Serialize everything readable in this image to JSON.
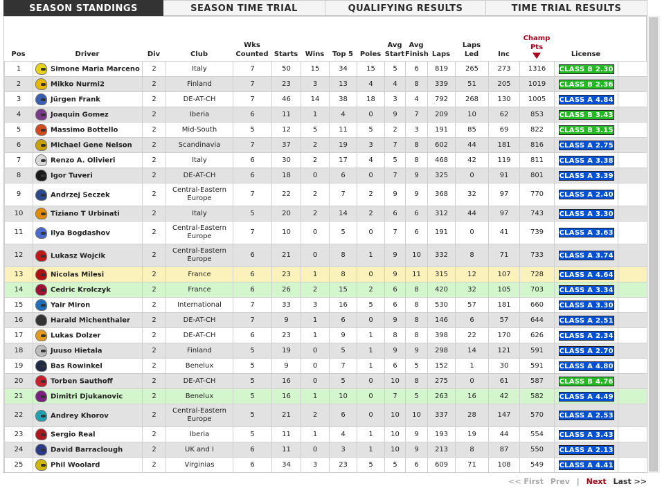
{
  "tabs": [
    {
      "label": "SEASON STANDINGS",
      "active": true
    },
    {
      "label": "SEASON TIME TRIAL",
      "active": false
    },
    {
      "label": "QUALIFYING RESULTS",
      "active": false
    },
    {
      "label": "TIME TRIAL RESULTS",
      "active": false
    }
  ],
  "columns": {
    "pos": "Pos",
    "driver": "Driver",
    "div": "Div",
    "club": "Club",
    "wks_line1": "Wks",
    "wks_line2": "Counted",
    "starts": "Starts",
    "wins": "Wins",
    "top5": "Top 5",
    "poles": "Poles",
    "avg_start_line1": "Avg",
    "avg_start_line2": "Start",
    "avg_finish_line1": "Avg",
    "avg_finish_line2": "Finish",
    "laps": "Laps",
    "laps_led_line1": "Laps",
    "laps_led_line2": "Led",
    "inc": "Inc",
    "champ_line1": "Champ",
    "champ_line2": "Pts",
    "license": "License"
  },
  "sort_icon": "sort-down-arrow-icon",
  "colors": {
    "accent": "#b0001b",
    "license_a": "#0050d8",
    "license_b": "#22bb22",
    "highlight_yellow": "#fbf1bb",
    "highlight_green": "#d4f6cc"
  },
  "rows": [
    {
      "pos": "1",
      "driver": "Simone Maria Marceno",
      "div": "2",
      "club": "Italy",
      "wks": "7",
      "starts": "50",
      "wins": "15",
      "top5": "34",
      "poles": "15",
      "avg_start": "5",
      "avg_finish": "6",
      "laps": "819",
      "laps_led": "265",
      "inc": "273",
      "pts": "1316",
      "license": "CLASS B 2.30",
      "license_class": "b",
      "helmet": "#e8d21a",
      "tall": false,
      "highlight": ""
    },
    {
      "pos": "2",
      "driver": "Mikko Nurmi2",
      "div": "2",
      "club": "Finland",
      "wks": "7",
      "starts": "23",
      "wins": "3",
      "top5": "13",
      "poles": "4",
      "avg_start": "4",
      "avg_finish": "8",
      "laps": "339",
      "laps_led": "51",
      "inc": "205",
      "pts": "1019",
      "license": "CLASS B 2.36",
      "license_class": "b",
      "helmet": "#e6b800",
      "tall": false,
      "highlight": ""
    },
    {
      "pos": "3",
      "driver": "Jürgen Frank",
      "div": "2",
      "club": "DE-AT-CH",
      "wks": "7",
      "starts": "46",
      "wins": "14",
      "top5": "38",
      "poles": "18",
      "avg_start": "3",
      "avg_finish": "4",
      "laps": "792",
      "laps_led": "268",
      "inc": "130",
      "pts": "1005",
      "license": "CLASS A 4.84",
      "license_class": "a",
      "helmet": "#3a5fb0",
      "tall": false,
      "highlight": ""
    },
    {
      "pos": "4",
      "driver": "Joaquin Gomez",
      "div": "2",
      "club": "Iberia",
      "wks": "6",
      "starts": "11",
      "wins": "1",
      "top5": "4",
      "poles": "0",
      "avg_start": "9",
      "avg_finish": "7",
      "laps": "209",
      "laps_led": "10",
      "inc": "62",
      "pts": "853",
      "license": "CLASS B 3.43",
      "license_class": "b",
      "helmet": "#7a3a8a",
      "tall": false,
      "highlight": ""
    },
    {
      "pos": "5",
      "driver": "Massimo Bottello",
      "div": "2",
      "club": "Mid-South",
      "wks": "5",
      "starts": "12",
      "wins": "5",
      "top5": "11",
      "poles": "5",
      "avg_start": "2",
      "avg_finish": "3",
      "laps": "191",
      "laps_led": "85",
      "inc": "69",
      "pts": "822",
      "license": "CLASS B 3.15",
      "license_class": "b",
      "helmet": "#d04a1c",
      "tall": false,
      "highlight": ""
    },
    {
      "pos": "6",
      "driver": "Michael Gene Nelson",
      "div": "2",
      "club": "Scandinavia",
      "wks": "7",
      "starts": "37",
      "wins": "2",
      "top5": "19",
      "poles": "3",
      "avg_start": "7",
      "avg_finish": "8",
      "laps": "602",
      "laps_led": "44",
      "inc": "181",
      "pts": "816",
      "license": "CLASS A 2.75",
      "license_class": "a",
      "helmet": "#c8a000",
      "tall": false,
      "highlight": ""
    },
    {
      "pos": "7",
      "driver": "Renzo A. Olivieri",
      "div": "2",
      "club": "Italy",
      "wks": "6",
      "starts": "30",
      "wins": "2",
      "top5": "17",
      "poles": "4",
      "avg_start": "5",
      "avg_finish": "8",
      "laps": "468",
      "laps_led": "42",
      "inc": "119",
      "pts": "811",
      "license": "CLASS A 3.38",
      "license_class": "a",
      "helmet": "#d8d8d8",
      "tall": false,
      "highlight": ""
    },
    {
      "pos": "8",
      "driver": "Igor Tuveri",
      "div": "2",
      "club": "DE-AT-CH",
      "wks": "6",
      "starts": "18",
      "wins": "0",
      "top5": "6",
      "poles": "0",
      "avg_start": "7",
      "avg_finish": "9",
      "laps": "325",
      "laps_led": "0",
      "inc": "91",
      "pts": "801",
      "license": "CLASS A 3.39",
      "license_class": "a",
      "helmet": "#1a1a1a",
      "tall": false,
      "highlight": ""
    },
    {
      "pos": "9",
      "driver": "Andrzej Seczek",
      "div": "2",
      "club": "Central-Eastern Europe",
      "wks": "7",
      "starts": "22",
      "wins": "2",
      "top5": "7",
      "poles": "2",
      "avg_start": "9",
      "avg_finish": "9",
      "laps": "368",
      "laps_led": "32",
      "inc": "97",
      "pts": "770",
      "license": "CLASS A 2.40",
      "license_class": "a",
      "helmet": "#2d4a8c",
      "tall": true,
      "highlight": ""
    },
    {
      "pos": "10",
      "driver": "Tiziano T Urbinati",
      "div": "2",
      "club": "Italy",
      "wks": "5",
      "starts": "20",
      "wins": "2",
      "top5": "14",
      "poles": "2",
      "avg_start": "6",
      "avg_finish": "6",
      "laps": "312",
      "laps_led": "44",
      "inc": "97",
      "pts": "743",
      "license": "CLASS A 3.30",
      "license_class": "a",
      "helmet": "#e28a00",
      "tall": false,
      "highlight": ""
    },
    {
      "pos": "11",
      "driver": "Ilya Bogdashov",
      "div": "2",
      "club": "Central-Eastern Europe",
      "wks": "7",
      "starts": "10",
      "wins": "0",
      "top5": "5",
      "poles": "0",
      "avg_start": "7",
      "avg_finish": "6",
      "laps": "191",
      "laps_led": "0",
      "inc": "41",
      "pts": "739",
      "license": "CLASS A 3.63",
      "license_class": "a",
      "helmet": "#4a6ad0",
      "tall": true,
      "highlight": ""
    },
    {
      "pos": "12",
      "driver": "Lukasz Wojcik",
      "div": "2",
      "club": "Central-Eastern Europe",
      "wks": "6",
      "starts": "21",
      "wins": "0",
      "top5": "8",
      "poles": "1",
      "avg_start": "9",
      "avg_finish": "10",
      "laps": "332",
      "laps_led": "8",
      "inc": "71",
      "pts": "733",
      "license": "CLASS A 3.74",
      "license_class": "a",
      "helmet": "#c01818",
      "tall": true,
      "highlight": ""
    },
    {
      "pos": "13",
      "driver": "Nicolas Milesi",
      "div": "2",
      "club": "France",
      "wks": "6",
      "starts": "23",
      "wins": "1",
      "top5": "8",
      "poles": "0",
      "avg_start": "9",
      "avg_finish": "11",
      "laps": "315",
      "laps_led": "12",
      "inc": "107",
      "pts": "728",
      "license": "CLASS A 4.64",
      "license_class": "a",
      "helmet": "#b01010",
      "tall": false,
      "highlight": "yellow"
    },
    {
      "pos": "14",
      "driver": "Cedric Krolczyk",
      "div": "2",
      "club": "France",
      "wks": "6",
      "starts": "26",
      "wins": "2",
      "top5": "15",
      "poles": "2",
      "avg_start": "6",
      "avg_finish": "8",
      "laps": "420",
      "laps_led": "32",
      "inc": "105",
      "pts": "703",
      "license": "CLASS A 3.34",
      "license_class": "a",
      "helmet": "#a01030",
      "tall": false,
      "highlight": "green"
    },
    {
      "pos": "15",
      "driver": "Yair Miron",
      "div": "2",
      "club": "International",
      "wks": "7",
      "starts": "33",
      "wins": "3",
      "top5": "16",
      "poles": "5",
      "avg_start": "6",
      "avg_finish": "8",
      "laps": "530",
      "laps_led": "57",
      "inc": "181",
      "pts": "660",
      "license": "CLASS A 3.30",
      "license_class": "a",
      "helmet": "#1f6fb8",
      "tall": false,
      "highlight": ""
    },
    {
      "pos": "16",
      "driver": "Harald Michenthaler",
      "div": "2",
      "club": "DE-AT-CH",
      "wks": "7",
      "starts": "9",
      "wins": "1",
      "top5": "6",
      "poles": "0",
      "avg_start": "9",
      "avg_finish": "8",
      "laps": "146",
      "laps_led": "6",
      "inc": "57",
      "pts": "644",
      "license": "CLASS A 2.51",
      "license_class": "a",
      "helmet": "#333333",
      "tall": false,
      "highlight": ""
    },
    {
      "pos": "17",
      "driver": "Lukas Dolzer",
      "div": "2",
      "club": "DE-AT-CH",
      "wks": "6",
      "starts": "23",
      "wins": "1",
      "top5": "9",
      "poles": "1",
      "avg_start": "8",
      "avg_finish": "8",
      "laps": "398",
      "laps_led": "22",
      "inc": "170",
      "pts": "626",
      "license": "CLASS A 2.34",
      "license_class": "a",
      "helmet": "#e29a20",
      "tall": false,
      "highlight": ""
    },
    {
      "pos": "18",
      "driver": "Juuso Hietala",
      "div": "2",
      "club": "Finland",
      "wks": "5",
      "starts": "19",
      "wins": "0",
      "top5": "5",
      "poles": "1",
      "avg_start": "9",
      "avg_finish": "9",
      "laps": "298",
      "laps_led": "14",
      "inc": "121",
      "pts": "591",
      "license": "CLASS A 2.70",
      "license_class": "a",
      "helmet": "#bcbcbc",
      "tall": false,
      "highlight": ""
    },
    {
      "pos": "19",
      "driver": "Bas Rowinkel",
      "div": "2",
      "club": "Benelux",
      "wks": "5",
      "starts": "9",
      "wins": "0",
      "top5": "7",
      "poles": "1",
      "avg_start": "6",
      "avg_finish": "5",
      "laps": "152",
      "laps_led": "1",
      "inc": "30",
      "pts": "591",
      "license": "CLASS A 4.80",
      "license_class": "a",
      "helmet": "#202a44",
      "tall": false,
      "highlight": ""
    },
    {
      "pos": "20",
      "driver": "Torben Sauthoff",
      "div": "2",
      "club": "DE-AT-CH",
      "wks": "5",
      "starts": "16",
      "wins": "0",
      "top5": "5",
      "poles": "0",
      "avg_start": "10",
      "avg_finish": "8",
      "laps": "275",
      "laps_led": "0",
      "inc": "61",
      "pts": "587",
      "license": "CLASS B 4.76",
      "license_class": "b",
      "helmet": "#c8202a",
      "tall": false,
      "highlight": ""
    },
    {
      "pos": "21",
      "driver": "Dimitri Djukanovic",
      "div": "2",
      "club": "Benelux",
      "wks": "5",
      "starts": "16",
      "wins": "1",
      "top5": "10",
      "poles": "0",
      "avg_start": "7",
      "avg_finish": "5",
      "laps": "263",
      "laps_led": "16",
      "inc": "42",
      "pts": "582",
      "license": "CLASS A 4.49",
      "license_class": "a",
      "helmet": "#7a2080",
      "tall": false,
      "highlight": "green"
    },
    {
      "pos": "22",
      "driver": "Andrey Khorov",
      "div": "2",
      "club": "Central-Eastern Europe",
      "wks": "5",
      "starts": "21",
      "wins": "2",
      "top5": "6",
      "poles": "0",
      "avg_start": "10",
      "avg_finish": "10",
      "laps": "337",
      "laps_led": "28",
      "inc": "147",
      "pts": "570",
      "license": "CLASS A 2.53",
      "license_class": "a",
      "helmet": "#20a0b0",
      "tall": true,
      "highlight": ""
    },
    {
      "pos": "23",
      "driver": "Sergio Real",
      "div": "2",
      "club": "Iberia",
      "wks": "5",
      "starts": "11",
      "wins": "1",
      "top5": "4",
      "poles": "1",
      "avg_start": "10",
      "avg_finish": "9",
      "laps": "193",
      "laps_led": "19",
      "inc": "44",
      "pts": "554",
      "license": "CLASS A 3.43",
      "license_class": "a",
      "helmet": "#b01820",
      "tall": false,
      "highlight": ""
    },
    {
      "pos": "24",
      "driver": "David Barraclough",
      "div": "2",
      "club": "UK and I",
      "wks": "6",
      "starts": "11",
      "wins": "0",
      "top5": "3",
      "poles": "1",
      "avg_start": "10",
      "avg_finish": "9",
      "laps": "213",
      "laps_led": "8",
      "inc": "87",
      "pts": "550",
      "license": "CLASS A 2.13",
      "license_class": "a",
      "helmet": "#2a3a88",
      "tall": false,
      "highlight": ""
    },
    {
      "pos": "25",
      "driver": "Phil Woolard",
      "div": "2",
      "club": "Virginias",
      "wks": "6",
      "starts": "34",
      "wins": "3",
      "top5": "23",
      "poles": "5",
      "avg_start": "5",
      "avg_finish": "6",
      "laps": "609",
      "laps_led": "71",
      "inc": "108",
      "pts": "549",
      "license": "CLASS A 4.41",
      "license_class": "a",
      "helmet": "#d0b800",
      "tall": false,
      "highlight": ""
    }
  ],
  "pager": {
    "first": "<< First",
    "prev": "Prev",
    "separator": "|",
    "next": "Next",
    "last": "Last >>"
  }
}
